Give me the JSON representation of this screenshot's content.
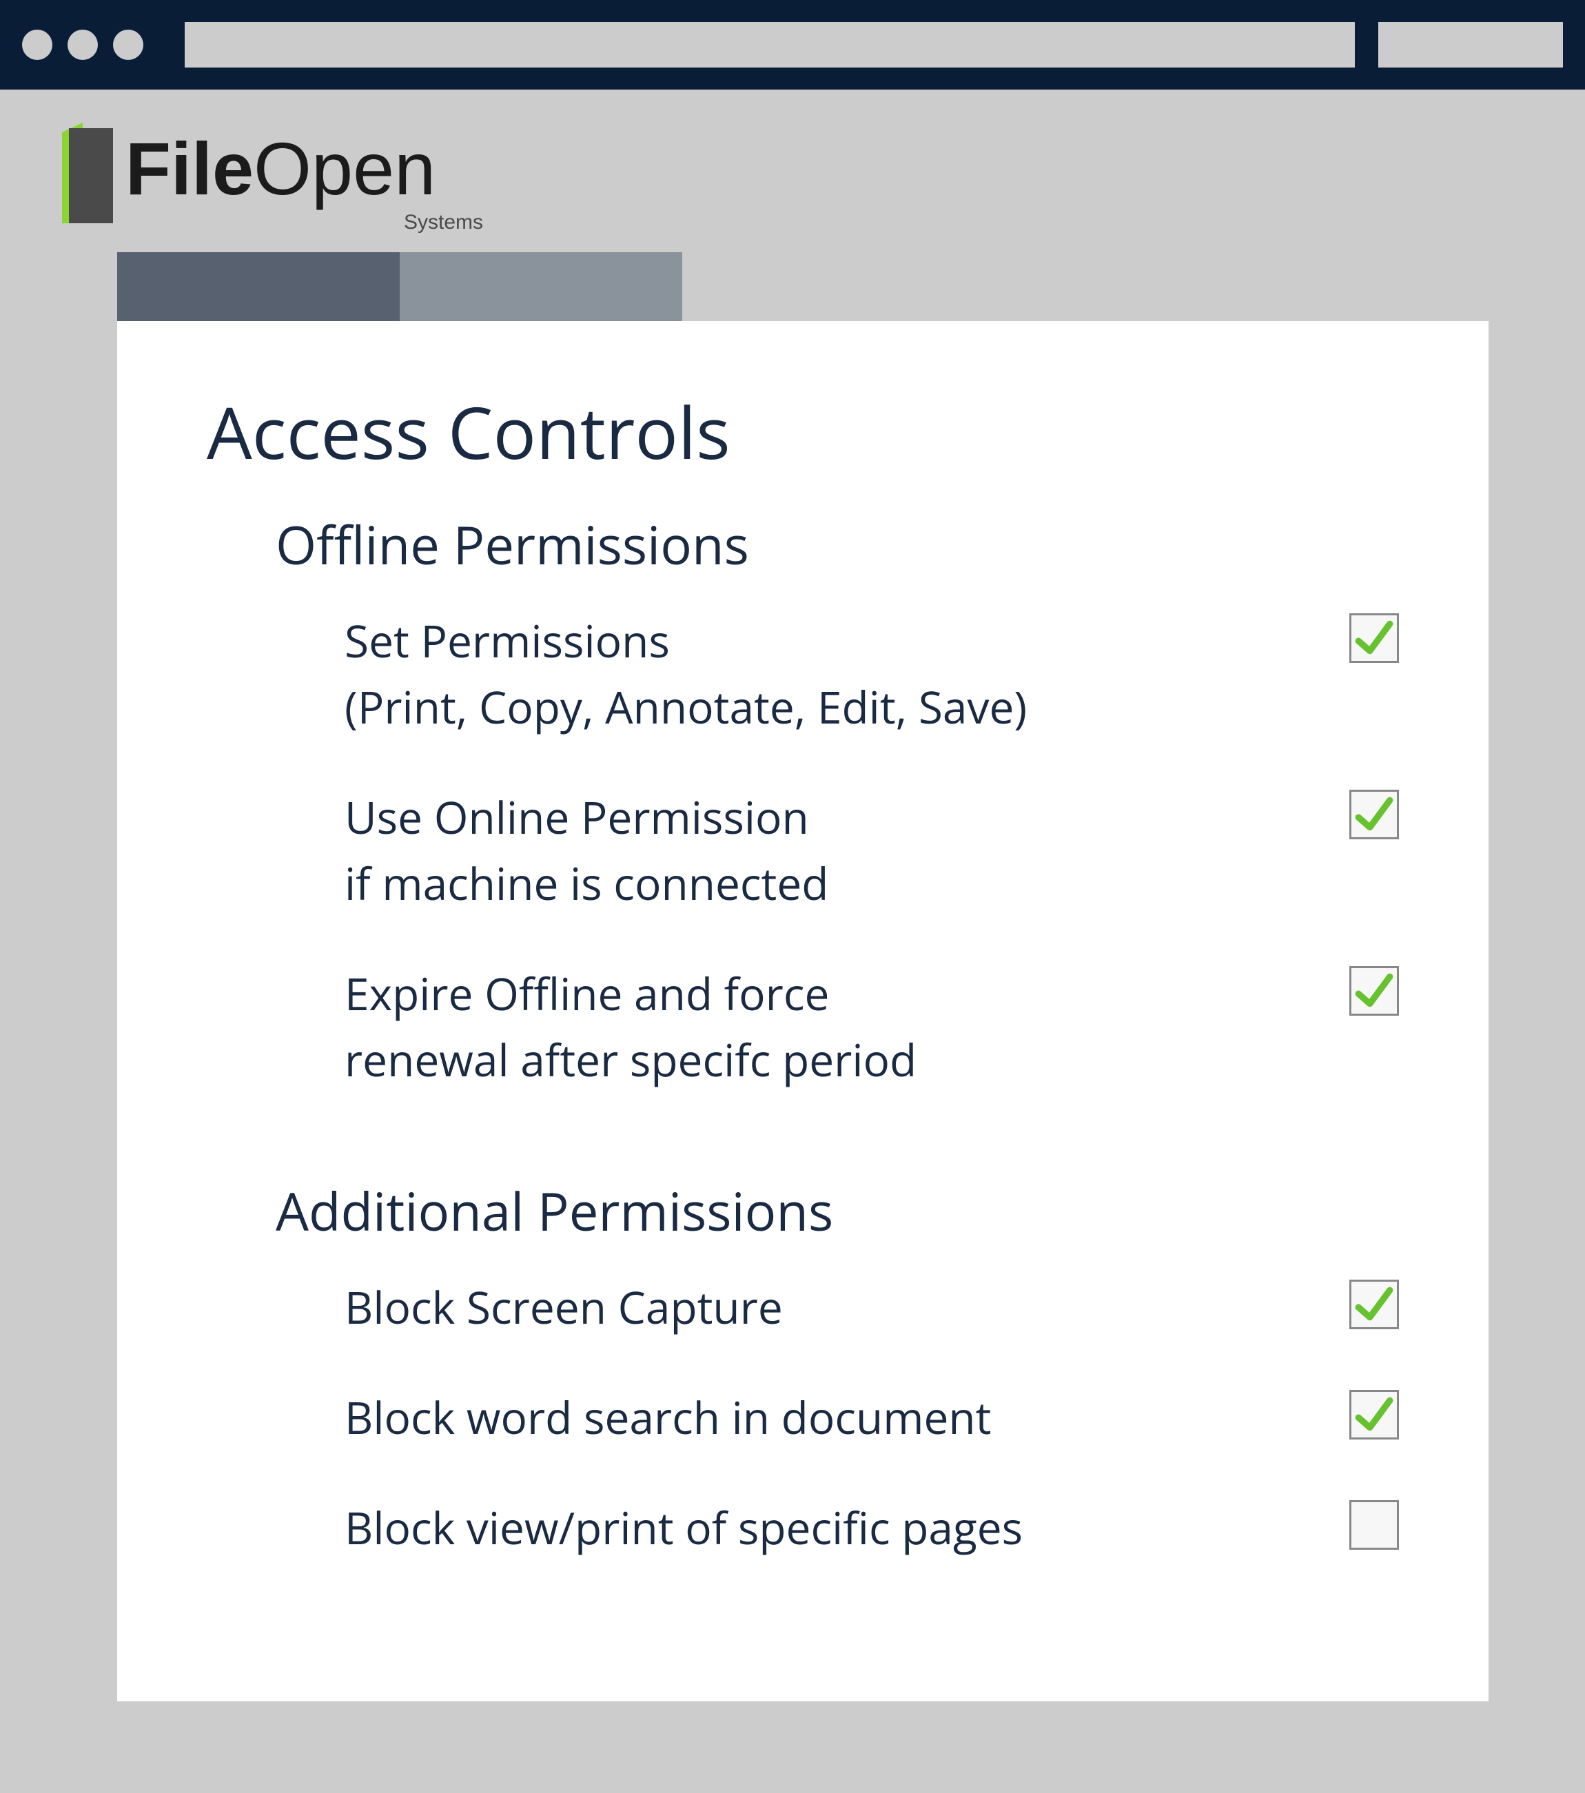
{
  "brand": {
    "name_bold": "File",
    "name_light": "Open",
    "subtitle": "Systems"
  },
  "colors": {
    "accent": "#8ad531",
    "ink": "#1a2a42",
    "tab_active": "#57616f",
    "tab_inactive": "#8a929b"
  },
  "tabs": [
    {
      "active": true
    },
    {
      "active": false
    }
  ],
  "page": {
    "title": "Access Controls",
    "sections": [
      {
        "title": "Offline Permissions",
        "items": [
          {
            "label": "Set Permissions\n(Print, Copy, Annotate, Edit, Save)",
            "checked": true
          },
          {
            "label": "Use Online Permission\nif machine is connected",
            "checked": true
          },
          {
            "label": "Expire Offline and force\nrenewal after specifc period",
            "checked": true
          }
        ]
      },
      {
        "title": "Additional Permissions",
        "items": [
          {
            "label": "Block Screen Capture",
            "checked": true
          },
          {
            "label": "Block word search in document",
            "checked": true
          },
          {
            "label": "Block view/print of specific pages",
            "checked": false
          }
        ]
      }
    ]
  }
}
